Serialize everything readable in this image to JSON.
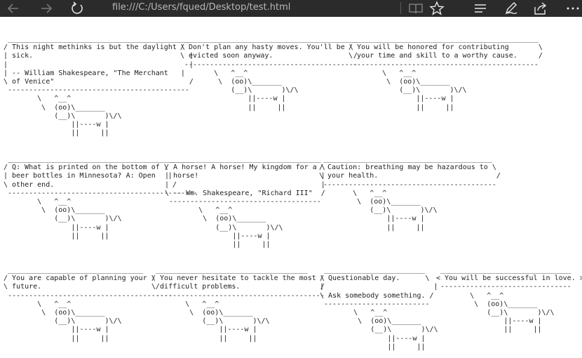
{
  "browser": {
    "address": "file:///C:/Users/fqued/Desktop/test.html",
    "icons": {
      "back": "back-arrow-icon",
      "forward": "forward-arrow-icon",
      "refresh": "refresh-icon",
      "reading_view": "reading-view-icon",
      "favorite": "star-icon",
      "hub": "hub-icon",
      "notes": "pen-icon",
      "share": "share-icon",
      "more": "more-icon"
    }
  },
  "cowsays": [
    " ___________________________________________\n/ This night methinks is but the daylight \\\n| sick.                                     |\n|                                           |\n| -- William Shakespeare, \"The Merchant   |\n\\ of Venice\"                                /\n -------------------------------------------\n        \\   ^__^\n         \\  (oo)\\_______\n            (__)\\       )\\/\\\n                ||----w |\n                ||     ||",
    " _________________________________________\n/ Don't plan any hasty moves. You'll be \\\n\\ evicted soon anyway.                   /\n -----------------------------------------\n        \\   ^__^\n         \\  (oo)\\_______\n            (__)\\       )\\/\\\n                ||----w |\n                ||     ||",
    " ____________________________________________\n/ You will be honored for contributing       \\\n\\ your time and skill to a worthy cause.     /\n --------------------------------------------\n        \\   ^__^\n         \\  (oo)\\_______\n            (__)\\       )\\/\\\n                ||----w |\n                ||     ||",
    " ____________________________________________\n/ Q: What is printed on the bottom of \\\n| beer bottles in Minnesota? A: Open   |\n\\ other end.                            /\n ---------------------------------------------\n        \\   ^__^\n         \\  (oo)\\_______\n            (__)\\       )\\/\\\n                ||----w |\n                ||     ||",
    " ____________________________________\n/ A horse! A horse! My kingdom for a \\\n| horse!                             |\n|                                    |\n\\ -- Wm. Shakespeare, \"Richard III\"  /\n ------------------------------------\n        \\   ^__^\n         \\  (oo)\\_______\n            (__)\\       )\\/\\\n                ||----w |\n                ||     ||",
    " ________________________________________\n/ Caution: breathing may be hazardous to \\\n\\ your health.                            /\n -----------------------------------------\n        \\   ^__^\n         \\  (oo)\\_______\n            (__)\\       )\\/\\\n                ||----w |\n                ||     ||",
    " ________________________________\n/ You are capable of planning your \\\n\\ future.                           /\n ---------------------------------------\n        \\   ^__^\n         \\  (oo)\\_______\n            (__)\\       )\\/\\\n                ||----w |\n                ||     ||",
    " ____________________________________\n/ You never hesitate to tackle the most \\\n\\ difficult problems.                   /\n ----------------------------------------\n        \\   ^__^\n         \\  (oo)\\_______\n            (__)\\       )\\/\\\n                ||----w |\n                ||     ||",
    " ________________________\n/ Questionable day.      \\\n|                          |\n\\ Ask somebody something. /\n -------------------------\n        \\   ^__^\n         \\  (oo)\\_______\n            (__)\\       )\\/\\\n                ||----w |\n                ||     ||",
    " _______________________________\n< You will be successful in love. >\n -------------------------------\n        \\   ^__^\n         \\  (oo)\\_______\n            (__)\\       )\\/\\\n                ||----w |\n                ||     ||"
  ]
}
